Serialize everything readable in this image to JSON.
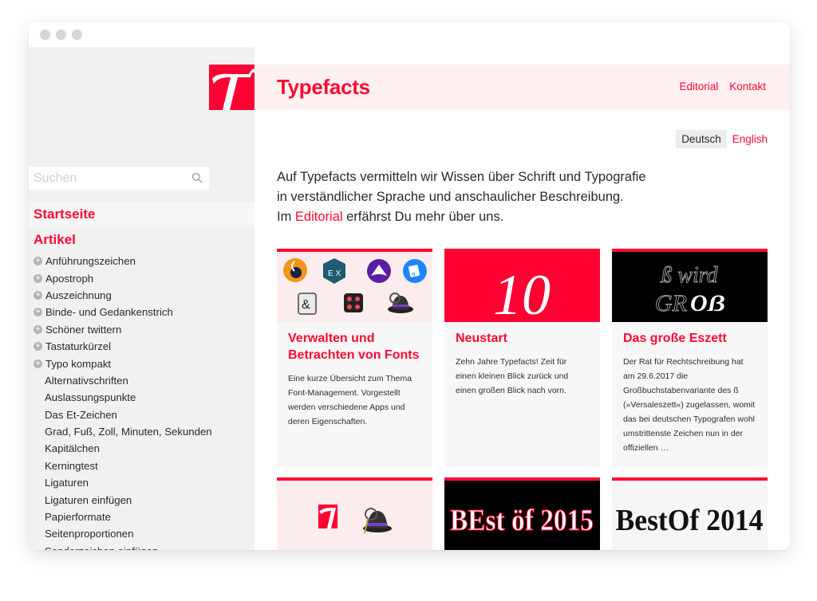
{
  "window": {
    "controls": [
      "close",
      "minimize",
      "maximize"
    ]
  },
  "sidebar": {
    "search": {
      "placeholder": "Suchen",
      "value": ""
    },
    "home_label": "Startseite",
    "articles_label": "Artikel",
    "groups": [
      {
        "label": "Anführungszeichen",
        "expandable": true
      },
      {
        "label": "Apostroph",
        "expandable": true
      },
      {
        "label": "Auszeichnung",
        "expandable": true
      },
      {
        "label": "Binde- und Gedankenstrich",
        "expandable": true
      },
      {
        "label": "Schöner twittern",
        "expandable": true
      },
      {
        "label": "Tastaturkürzel",
        "expandable": true
      },
      {
        "label": "Typo kompakt",
        "expandable": true
      }
    ],
    "subitems": [
      "Alternativschriften",
      "Auslassungspunkte",
      "Das Et-Zeichen",
      "Grad, Fuß, Zoll, Minuten, Sekunden",
      "Kapitälchen",
      "Kerningtest",
      "Ligaturen",
      "Ligaturen einfügen",
      "Papierformate",
      "Seitenproportionen",
      "Sonderzeichen einfügen"
    ]
  },
  "header": {
    "logo_letter": "T",
    "title": "Typefacts",
    "nav": [
      "Editorial",
      "Kontakt"
    ]
  },
  "language": {
    "current": "Deutsch",
    "other": "English"
  },
  "intro": {
    "line1": "Auf Typefacts vermitteln wir Wissen über Schrift und Typografie",
    "line2": "in verständlicher Sprache und anschaulicher Beschreibung.",
    "line3_pre": "Im ",
    "line3_link": "Editorial",
    "line3_post": " erfährst Du mehr über uns."
  },
  "cards": [
    {
      "title": "Verwalten und Betrachten von Fonts",
      "text": "Eine kurze Übersicht zum Thema Font-Management. Vorgestellt werden verschiedene Apps und deren Eigenschaften.",
      "image": "font-manager-app-icons"
    },
    {
      "title": "Neustart",
      "text": "Zehn Jahre Typefacts! Zeit für einen kleinen Blick zurück und einen großen Blick nach vorn.",
      "image": "script-10",
      "image_text": "10"
    },
    {
      "title": "Das große Eszett",
      "text": "Der Rat für Rechtschreibung hat am 29.6.2017 die Großbuchstabenvariante des ß (»Versaleszett«) zugelassen, womit das bei deutschen Typografen wohl umstrittenste Zeichen nun in der offiziellen …",
      "image": "eszett-lettering",
      "image_line1": "ß wird",
      "image_line2a": "GR",
      "image_line2b": "Oẞ"
    },
    {
      "title": "",
      "text": "",
      "image": "typefacts-logo-and-alfred-hat"
    },
    {
      "title": "",
      "text": "",
      "image": "best-of-2015-lettering",
      "image_text": "BEst öf 2015"
    },
    {
      "title": "",
      "text": "",
      "image": "best-of-2014-lettering",
      "image_text": "BestOf 2014"
    }
  ],
  "colors": {
    "accent": "#ff0a32",
    "header_bg": "#fff0f2",
    "sidebar_bg": "#f1f1f1",
    "card_bg": "#f7f7f7"
  }
}
